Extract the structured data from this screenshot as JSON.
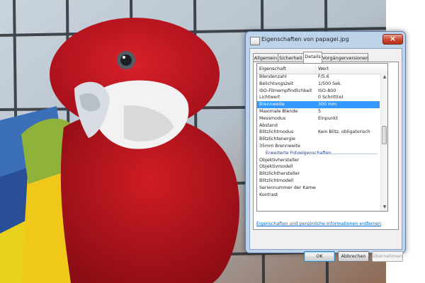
{
  "dialog": {
    "title": "Eigenschaften von papagei.jpg",
    "tabs": [
      {
        "label": "Allgemein",
        "active": false
      },
      {
        "label": "Sicherheit",
        "active": false
      },
      {
        "label": "Details",
        "active": true
      },
      {
        "label": "Vorgängerversionen",
        "active": false
      }
    ],
    "columns": {
      "property": "Eigenschaft",
      "value": "Wert"
    },
    "rows": [
      {
        "property": "Blendenzahl",
        "value": "F/5.6"
      },
      {
        "property": "Belichtungszeit",
        "value": "1/500 Sek."
      },
      {
        "property": "ISO-Filmempfindlichkeit",
        "value": "ISO-800"
      },
      {
        "property": "Lichtwert",
        "value": "0 Schritt(e)"
      },
      {
        "property": "Brennweite",
        "value": "300 mm",
        "selected": true
      },
      {
        "property": "Maximale Blende",
        "value": "5"
      },
      {
        "property": "Messmodus",
        "value": "Einpunkt"
      },
      {
        "property": "Abstand",
        "value": ""
      },
      {
        "property": "Blitzlichtmodus",
        "value": "Kein Blitz, obligatorisch"
      },
      {
        "property": "Blitzlichtenergie",
        "value": ""
      },
      {
        "property": "35mm Brennweite",
        "value": ""
      }
    ],
    "group_header": "Erweiterte Fotoeigenschaften",
    "rows2": [
      {
        "property": "Objektivhersteller",
        "value": ""
      },
      {
        "property": "Objektivmodell",
        "value": ""
      },
      {
        "property": "Blitzlichthersteller",
        "value": ""
      },
      {
        "property": "Blitzlichtmodell",
        "value": ""
      },
      {
        "property": "Seriennummer der Kamera",
        "value": ""
      },
      {
        "property": "Kontrast",
        "value": ""
      }
    ],
    "remove_link": "Eigenschaften und persönliche Informationen entfernen",
    "buttons": {
      "ok": "OK",
      "cancel": "Abbrechen",
      "apply": "Übernehmen"
    },
    "close_icon": "×",
    "scroll_up_icon": "▲",
    "scroll_down_icon": "▼",
    "selection_color": "#3399ff",
    "link_color": "#0066cc"
  },
  "icons": [
    "file-icon",
    "close-icon",
    "scroll-up-icon",
    "scroll-down-icon"
  ]
}
